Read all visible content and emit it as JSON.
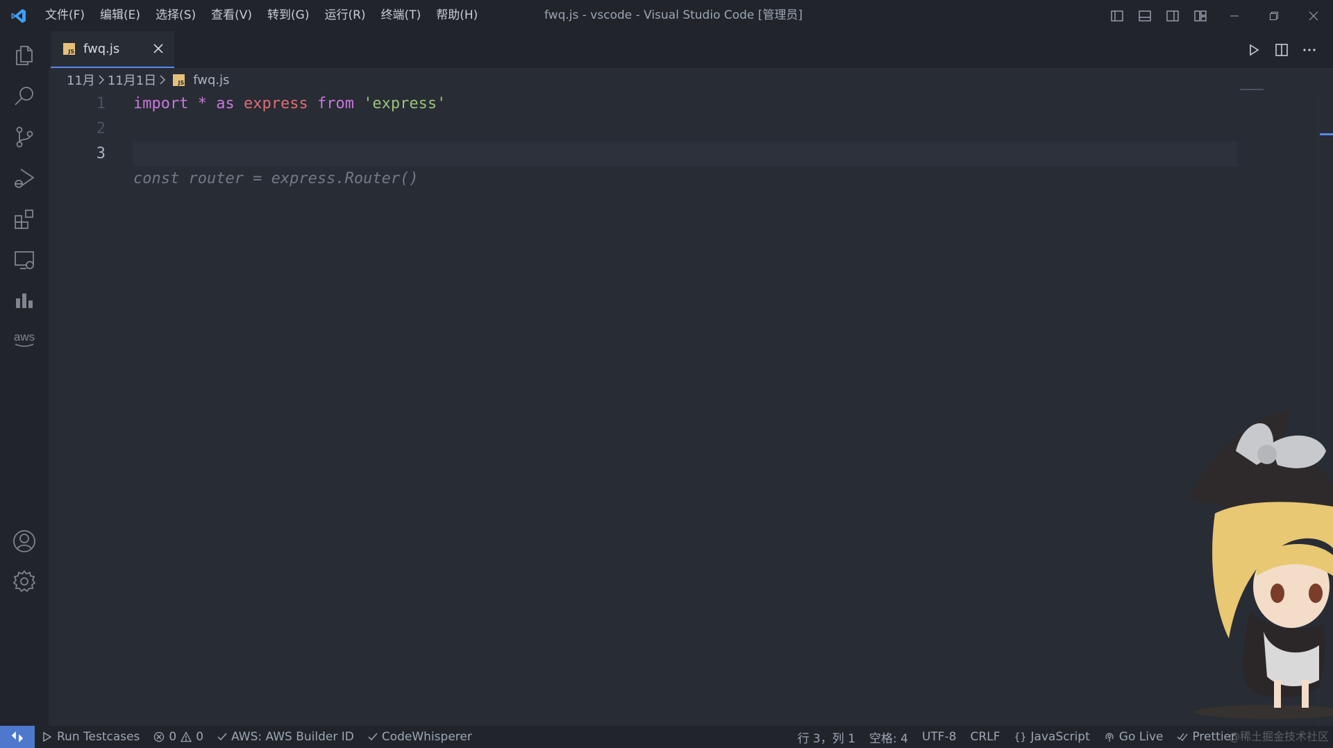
{
  "titlebar": {
    "menu": [
      "文件(F)",
      "编辑(E)",
      "选择(S)",
      "查看(V)",
      "转到(G)",
      "运行(R)",
      "终端(T)",
      "帮助(H)"
    ],
    "title": "fwq.js - vscode - Visual Studio Code [管理员]"
  },
  "activity_icons": [
    "files-icon",
    "search-icon",
    "source-control-icon",
    "run-debug-icon",
    "extensions-icon",
    "remote-explorer-icon",
    "chart-icon",
    "aws-icon",
    "accounts-icon",
    "settings-gear-icon"
  ],
  "aws_label": "aws",
  "tab": {
    "badge": "JS",
    "label": "fwq.js"
  },
  "breadcrumb": {
    "segments": [
      "11月",
      "11月1日"
    ],
    "file": "fwq.js",
    "badge": "JS"
  },
  "editor": {
    "line_numbers": [
      "1",
      "2",
      "3"
    ],
    "active_line": "3",
    "line1": {
      "kw1": "import",
      "star": "*",
      "kw2": "as",
      "name": "express",
      "kw3": "from",
      "str": "'express'"
    },
    "suggestion": "const router = express.Router()"
  },
  "statusbar": {
    "run_testcases": "Run Testcases",
    "errors": "0",
    "warnings": "0",
    "aws": "AWS: AWS Builder ID",
    "codewhisperer": "CodeWhisperer",
    "position": "行 3，列 1",
    "spaces": "空格: 4",
    "encoding": "UTF-8",
    "eol": "CRLF",
    "language": "JavaScript",
    "go_live": "Go Live",
    "prettier": "Prettier",
    "watermark": "@稀土掘金技术社区"
  },
  "colors": {
    "accent": "#568af2",
    "remote": "#4d78cc",
    "background": "#282c34",
    "chrome": "#21252b"
  }
}
